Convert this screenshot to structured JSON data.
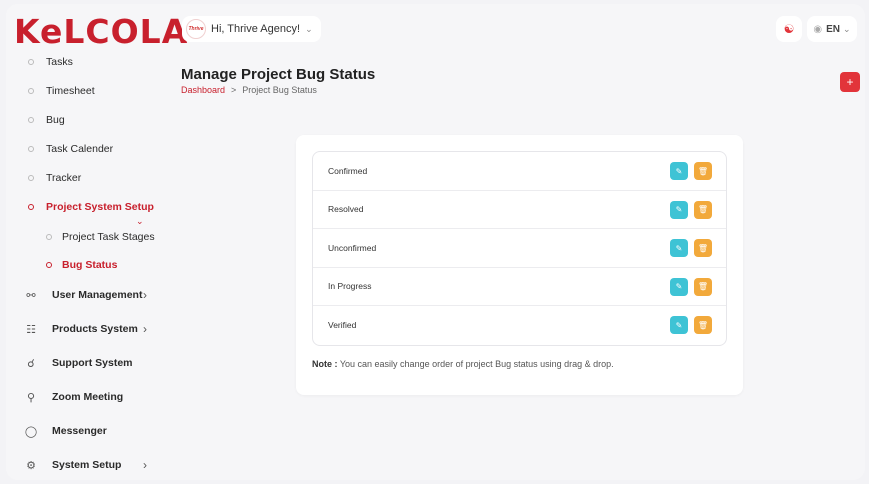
{
  "brand": {
    "logo": "KeLCOLA"
  },
  "sidebar": {
    "items": [
      {
        "label": "Tasks"
      },
      {
        "label": "Timesheet"
      },
      {
        "label": "Bug"
      },
      {
        "label": "Task Calender"
      },
      {
        "label": "Tracker"
      },
      {
        "label": "Project System Setup"
      },
      {
        "label": "Project Task Stages"
      },
      {
        "label": "Bug Status"
      }
    ],
    "main": [
      {
        "label": "User Management",
        "icon": "users-icon"
      },
      {
        "label": "Products System",
        "icon": "cart-icon"
      },
      {
        "label": "Support System",
        "icon": "headset-icon"
      },
      {
        "label": "Zoom Meeting",
        "icon": "user-plus-icon"
      },
      {
        "label": "Messenger",
        "icon": "chat-icon"
      },
      {
        "label": "System Setup",
        "icon": "gear-icon"
      }
    ]
  },
  "header": {
    "greeting": "Hi, Thrive Agency!",
    "avatar_text": "Thrive",
    "language": "EN"
  },
  "page": {
    "title": "Manage Project Bug Status",
    "breadcrumb": [
      "Dashboard",
      ">",
      "Project Bug Status"
    ],
    "add_label": "+"
  },
  "statuses": [
    "Confirmed",
    "Resolved",
    "Unconfirmed",
    "In Progress",
    "Verified"
  ],
  "note": {
    "label": "Note :",
    "text": "You can easily change order of project Bug status using drag & drop."
  },
  "colors": {
    "brand": "#c8202d",
    "edit": "#3ec3d5",
    "delete": "#f2a93b",
    "add": "#e2343a"
  }
}
